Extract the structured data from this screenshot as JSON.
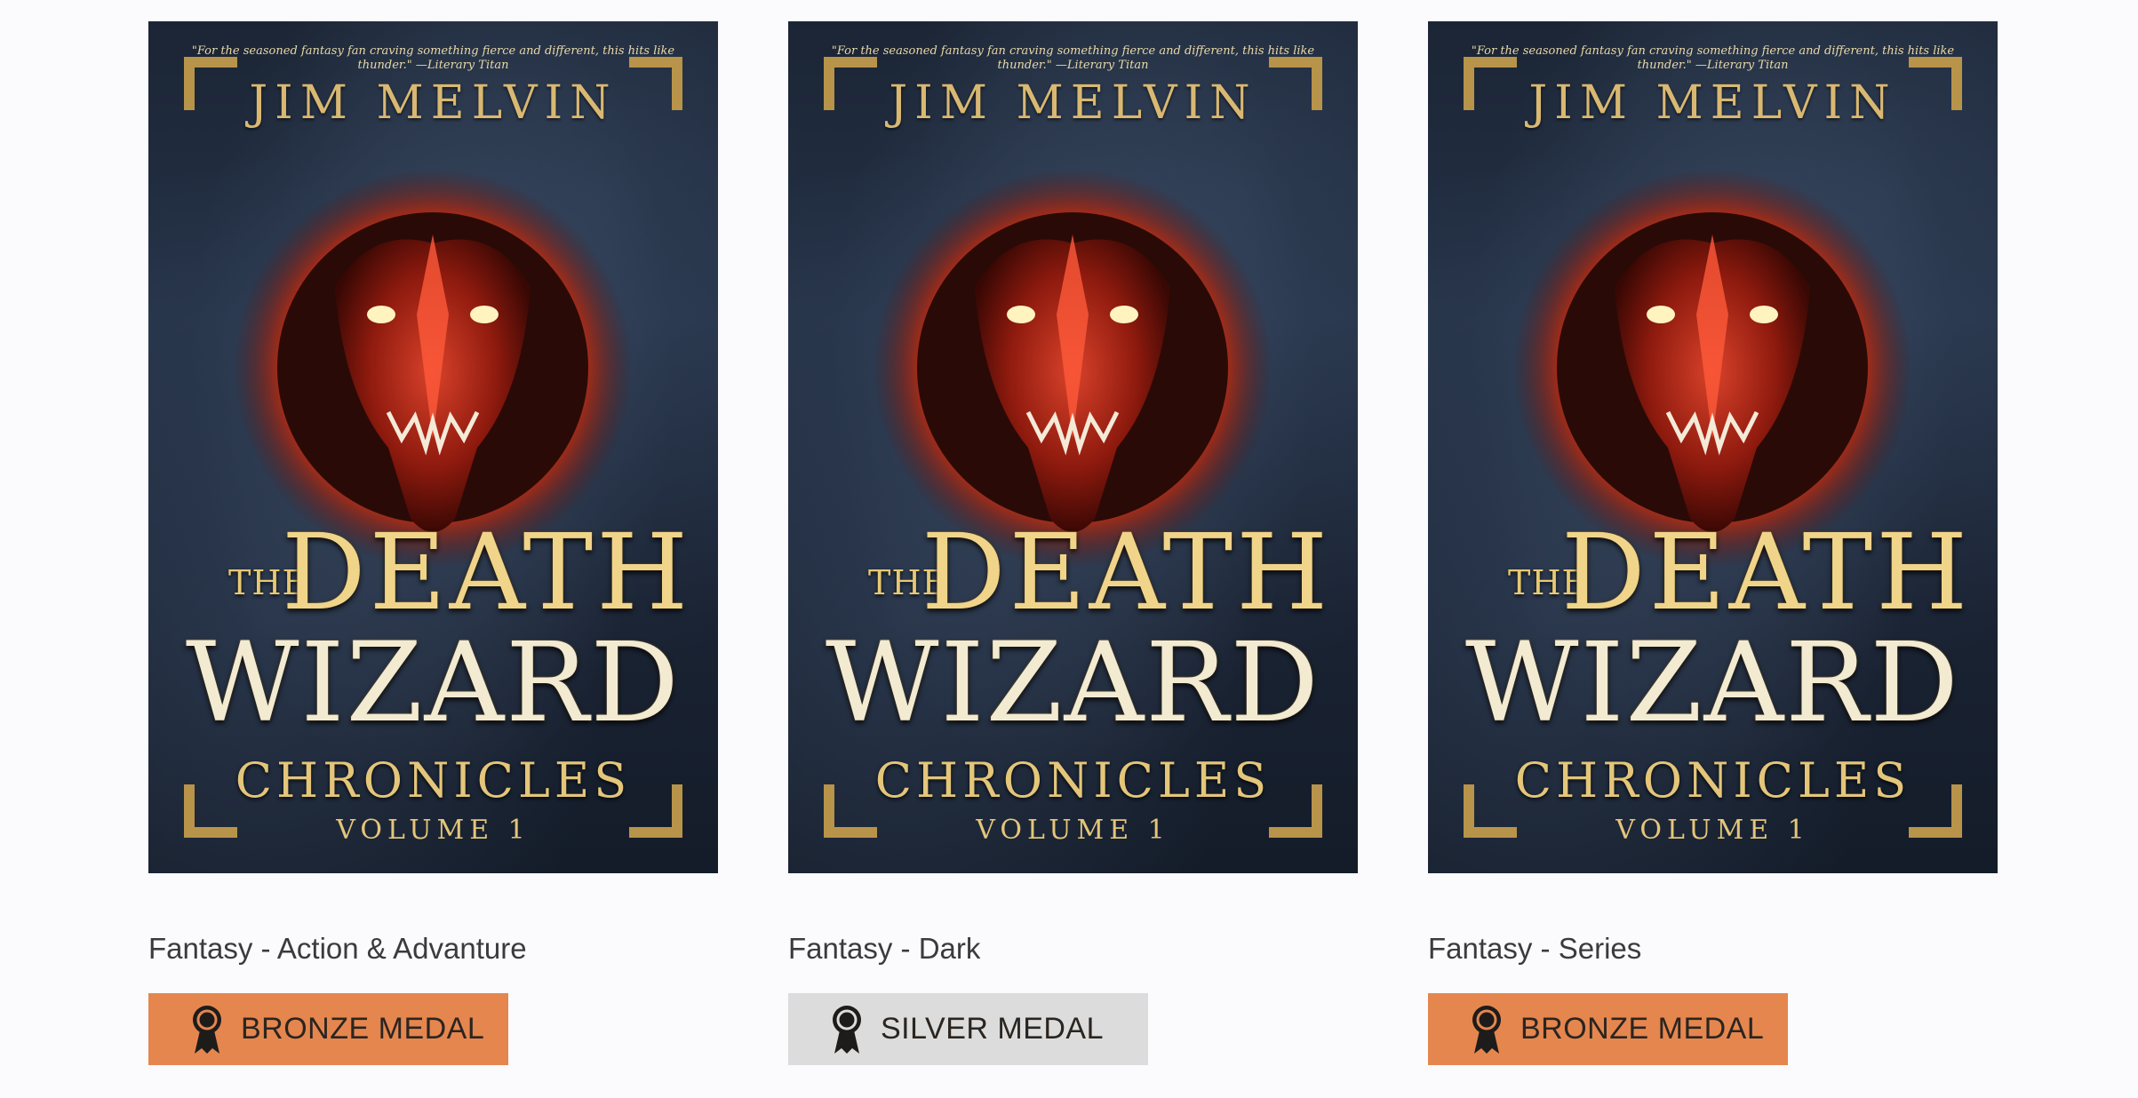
{
  "colors": {
    "page_background": "#fbfafd",
    "bronze_medal": "#e5864f",
    "silver_medal": "#dddcdc",
    "medal_icon": "#1e1c1a"
  },
  "cover": {
    "quote": "\"For the seasoned fantasy fan craving something fierce and different, this hits like thunder.\" —Literary Titan",
    "author": "JIM MELVIN",
    "title_the": "THE",
    "title_death": "DEATH",
    "title_wizard": "WIZARD",
    "title_chronicles": "CHRONICLES",
    "title_volume": "VOLUME 1"
  },
  "awards": [
    {
      "category": "Fantasy - Action & Advanture",
      "medal": "BRONZE MEDAL",
      "medal_icon": "award-ribbon-icon",
      "medal_type": "bronze"
    },
    {
      "category": "Fantasy - Dark",
      "medal": "SILVER MEDAL",
      "medal_icon": "award-ribbon-icon",
      "medal_type": "silver"
    },
    {
      "category": "Fantasy - Series",
      "medal": "BRONZE MEDAL",
      "medal_icon": "award-ribbon-icon",
      "medal_type": "bronze"
    }
  ]
}
